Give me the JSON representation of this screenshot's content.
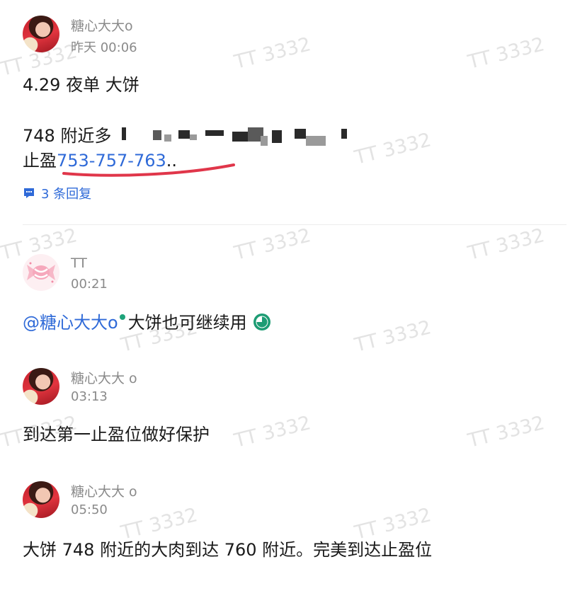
{
  "watermark": "TT 3332",
  "posts": [
    {
      "author": "糖心大大o",
      "time": "昨天 00:06",
      "line1": "4.29 夜单 大饼",
      "line2_prefix": "748 附近多",
      "line3_prefix": "止盈",
      "line3_link": "753-757-763",
      "line3_suffix": "..",
      "replies": "3 条回复"
    },
    {
      "author": "TT",
      "time": "00:21",
      "mention": "@糖心大大o",
      "text": "大饼也可继续用"
    },
    {
      "author": "糖心大大 o",
      "time": "03:13",
      "text": "到达第一止盈位做好保护"
    },
    {
      "author": "糖心大大 o",
      "time": "05:50",
      "text": "大饼 748 附近的大肉到达 760 附近。完美到达止盈位"
    }
  ],
  "icons": {
    "reply": "comment-icon",
    "clock": "clock-icon",
    "candy": "candy-avatar-icon"
  },
  "colors": {
    "link": "#2f6ad8",
    "meta": "#8a8a8a",
    "underline": "#e0364a",
    "online": "#1ea37a"
  }
}
